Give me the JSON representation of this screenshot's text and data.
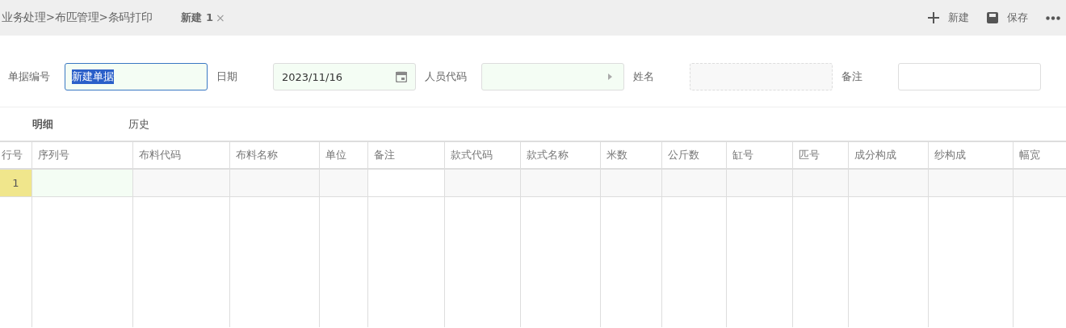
{
  "breadcrumb": "业务处理>布匹管理>条码打印",
  "document_tab": {
    "label": "新建 1",
    "close": "×"
  },
  "toolbar": [
    {
      "kind": "new",
      "label": "新建"
    },
    {
      "kind": "save",
      "label": "保存"
    },
    {
      "kind": "more"
    }
  ],
  "form": [
    {
      "label": "单据编号",
      "kind": "text",
      "value": "新建单据",
      "focused": true,
      "text_selected": true
    },
    {
      "label": "日期",
      "kind": "date",
      "value": "2023/11/16"
    },
    {
      "label": "人员代码",
      "kind": "picker"
    },
    {
      "label": "姓名",
      "kind": "readonly"
    },
    {
      "label": "备注",
      "kind": "plain"
    }
  ],
  "detail_tabs": [
    {
      "label": "明细",
      "selected": true
    },
    {
      "label": "历史",
      "selected": false
    }
  ],
  "table": {
    "columns": [
      {
        "label": "行号",
        "kind": "index"
      },
      {
        "label": "序列号",
        "kind": "editable"
      },
      {
        "label": "布料代码",
        "kind": "readonly"
      },
      {
        "label": "布料名称",
        "kind": "readonly"
      },
      {
        "label": "单位",
        "kind": "readonly"
      },
      {
        "label": "备注",
        "kind": "plain"
      },
      {
        "label": "款式代码",
        "kind": "readonly"
      },
      {
        "label": "款式名称",
        "kind": "readonly"
      },
      {
        "label": "米数",
        "kind": "readonly"
      },
      {
        "label": "公斤数",
        "kind": "readonly"
      },
      {
        "label": "缸号",
        "kind": "readonly"
      },
      {
        "label": "匹号",
        "kind": "readonly"
      },
      {
        "label": "成分构成",
        "kind": "readonly"
      },
      {
        "label": "纱构成",
        "kind": "readonly"
      },
      {
        "label": "幅宽",
        "kind": "readonly"
      }
    ],
    "rows": [
      {
        "row_number": "1"
      }
    ]
  }
}
